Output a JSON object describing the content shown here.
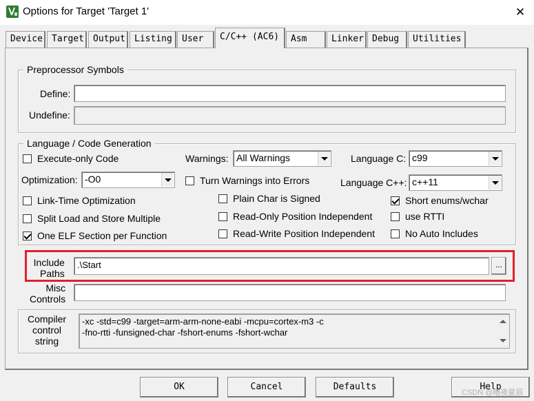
{
  "window": {
    "title": "Options for Target 'Target 1'",
    "close_glyph": "✕"
  },
  "tabs": [
    {
      "label": "Device",
      "active": false
    },
    {
      "label": "Target",
      "active": false
    },
    {
      "label": "Output",
      "active": false
    },
    {
      "label": "Listing",
      "active": false
    },
    {
      "label": "User",
      "active": false
    },
    {
      "label": "C/C++ (AC6)",
      "active": true
    },
    {
      "label": "Asm",
      "active": false
    },
    {
      "label": "Linker",
      "active": false
    },
    {
      "label": "Debug",
      "active": false
    },
    {
      "label": "Utilities",
      "active": false
    }
  ],
  "preprocessor": {
    "legend": "Preprocessor Symbols",
    "define_label": "Define:",
    "define_value": "",
    "undefine_label": "Undefine:",
    "undefine_value": ""
  },
  "codegen": {
    "legend": "Language / Code Generation",
    "execute_only": {
      "label": "Execute-only Code",
      "checked": false
    },
    "warnings": {
      "label": "Warnings:",
      "value": "All Warnings"
    },
    "language_c": {
      "label": "Language C:",
      "value": "c99"
    },
    "optimization": {
      "label": "Optimization:",
      "value": "-O0"
    },
    "turn_warnings_errors": {
      "label": "Turn Warnings into Errors",
      "checked": false
    },
    "language_cpp": {
      "label": "Language C++:",
      "value": "c++11"
    },
    "link_time": {
      "label": "Link-Time Optimization",
      "checked": false
    },
    "plain_char": {
      "label": "Plain Char is Signed",
      "checked": false
    },
    "short_enums": {
      "label": "Short enums/wchar",
      "checked": true
    },
    "split_load": {
      "label": "Split Load and Store Multiple",
      "checked": false
    },
    "ro_pi": {
      "label": "Read-Only Position Independent",
      "checked": false
    },
    "use_rtti": {
      "label": "use RTTI",
      "checked": false
    },
    "one_elf": {
      "label": "One ELF Section per Function",
      "checked": true
    },
    "rw_pi": {
      "label": "Read-Write Position Independent",
      "checked": false
    },
    "no_auto_includes": {
      "label": "No Auto Includes",
      "checked": false
    }
  },
  "include_paths": {
    "label_line1": "Include",
    "label_line2": "Paths",
    "value": ".\\Start",
    "browse_label": "..."
  },
  "misc_controls": {
    "label_line1": "Misc",
    "label_line2": "Controls",
    "value": ""
  },
  "compiler_control": {
    "label_line1": "Compiler",
    "label_line2": "control",
    "label_line3": "string",
    "line1": "-xc -std=c99 -target=arm-arm-none-eabi -mcpu=cortex-m3 -c",
    "line2": "-fno-rtti -funsigned-char -fshort-enums -fshort-wchar"
  },
  "buttons": {
    "ok": "OK",
    "cancel": "Cancel",
    "defaults": "Defaults",
    "help": "Help"
  },
  "watermark": "CSDN @暗夜星辰",
  "colors": {
    "highlight": "#e0202a",
    "app_icon": "#2e7d32"
  }
}
